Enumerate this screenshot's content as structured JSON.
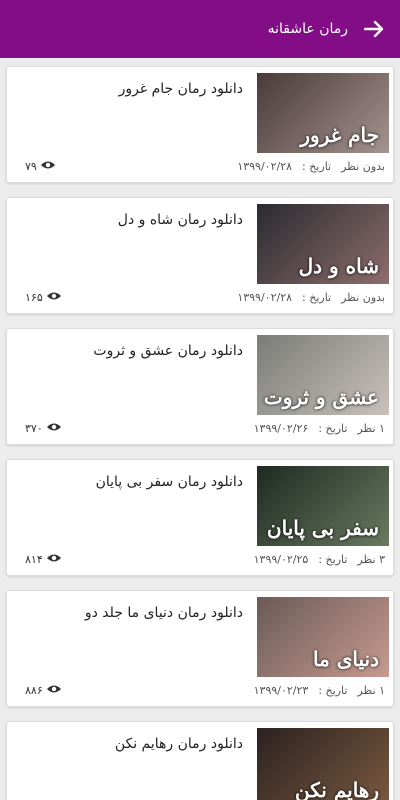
{
  "appbar": {
    "title": "رمان عاشقانه"
  },
  "items": [
    {
      "title": "دانلود رمان جام غرور",
      "comments": "بدون نظر",
      "date_label": "تاریخ :",
      "date": "۱۳۹۹/۰۲/۲۸",
      "views": "۷۹",
      "cover_text": "جام غرور",
      "color1": "#4a3a38",
      "color2": "#a4938f"
    },
    {
      "title": "دانلود رمان شاه و دل",
      "comments": "بدون نظر",
      "date_label": "تاریخ :",
      "date": "۱۳۹۹/۰۲/۲۸",
      "views": "۱۶۵",
      "cover_text": "شاه و دل",
      "color1": "#2a2b30",
      "color2": "#8d6d6d"
    },
    {
      "title": "دانلود رمان عشق و ثروت",
      "comments": "۱ نظر",
      "date_label": "تاریخ :",
      "date": "۱۳۹۹/۰۲/۲۶",
      "views": "۳۷۰",
      "cover_text": "عشق و ثروت",
      "color1": "#7a7c78",
      "color2": "#c9c1bb"
    },
    {
      "title": "دانلود رمان سفر بی پایان",
      "comments": "۳ نظر",
      "date_label": "تاریخ :",
      "date": "۱۳۹۹/۰۲/۲۵",
      "views": "۸۱۴",
      "cover_text": "سفر بی پایان",
      "color1": "#1e2a22",
      "color2": "#6a7a60"
    },
    {
      "title": "دانلود رمان دنیای ما جلد دو",
      "comments": "۱ نظر",
      "date_label": "تاریخ :",
      "date": "۱۳۹۹/۰۲/۲۳",
      "views": "۸۸۶",
      "cover_text": "دنیای ما",
      "color1": "#6b5a58",
      "color2": "#c69a8e"
    },
    {
      "title": "دانلود رمان رهایم نکن",
      "comments": "",
      "date_label": "",
      "date": "",
      "views": "",
      "cover_text": "رهایم نکن",
      "color1": "#2c2220",
      "color2": "#7a5a40"
    }
  ]
}
